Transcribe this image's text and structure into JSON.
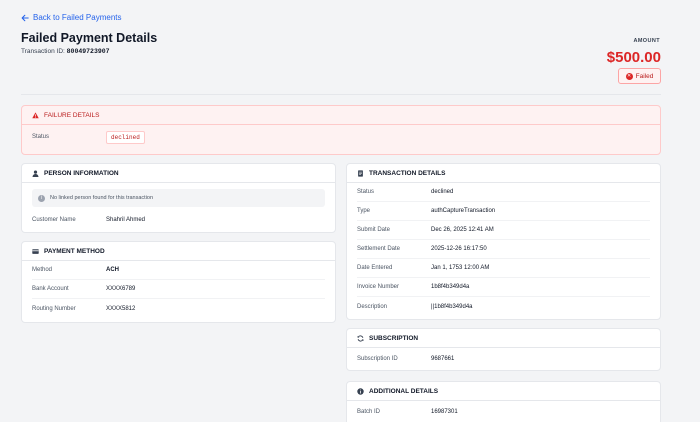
{
  "header": {
    "back_label": "Back to Failed Payments",
    "title": "Failed Payment Details",
    "transaction_label": "Transaction ID:",
    "transaction_id": "80049723907",
    "amount_label": "AMOUNT",
    "amount": "$500.00",
    "status_badge": "Failed"
  },
  "failure": {
    "title": "FAILURE DETAILS",
    "status_label": "Status",
    "status_value": "declined"
  },
  "person": {
    "title": "PERSON INFORMATION",
    "note": "No linked person found for this transaction",
    "customer_label": "Customer Name",
    "customer_value": "Shahril Ahmed"
  },
  "payment": {
    "title": "PAYMENT METHOD",
    "rows": [
      {
        "label": "Method",
        "value": "ACH"
      },
      {
        "label": "Bank Account",
        "value": "XXXX6789"
      },
      {
        "label": "Routing Number",
        "value": "XXXX5812"
      }
    ]
  },
  "transaction": {
    "title": "TRANSACTION DETAILS",
    "rows": [
      {
        "label": "Status",
        "value": "declined"
      },
      {
        "label": "Type",
        "value": "authCaptureTransaction"
      },
      {
        "label": "Submit Date",
        "value": "Dec 26, 2025 12:41 AM"
      },
      {
        "label": "Settlement Date",
        "value": "2025-12-26 16:17:50"
      },
      {
        "label": "Date Entered",
        "value": "Jan 1, 1753 12:00 AM"
      },
      {
        "label": "Invoice Number",
        "value": "1b8f4b349d4a"
      },
      {
        "label": "Description",
        "value": "||1b8f4b349d4a"
      }
    ]
  },
  "subscription": {
    "title": "SUBSCRIPTION",
    "id_label": "Subscription ID",
    "id_value": "9687661"
  },
  "additional": {
    "title": "ADDITIONAL DETAILS",
    "batch_label": "Batch ID",
    "batch_value": "16987301"
  },
  "colors": {
    "accent": "#2563eb",
    "danger": "#dc2626",
    "page_bg": "#f3f4f6"
  }
}
